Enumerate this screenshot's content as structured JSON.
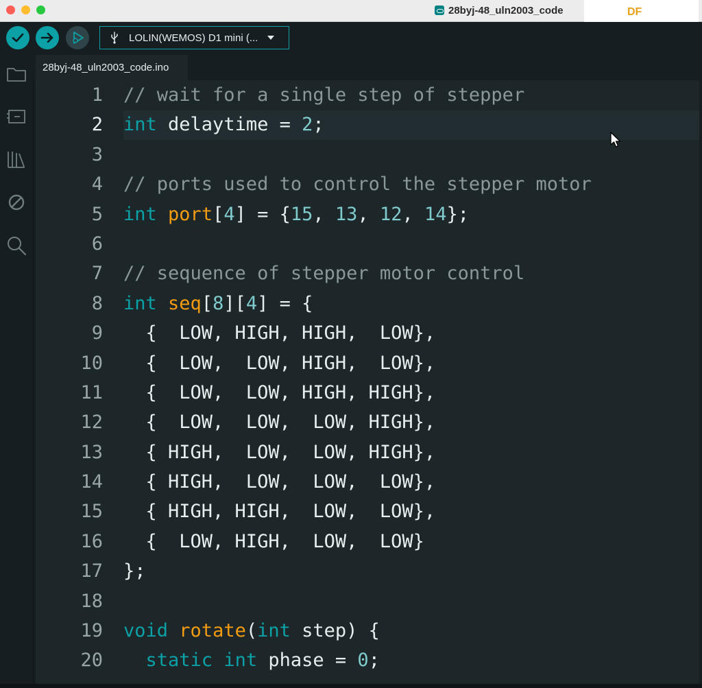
{
  "window": {
    "title": "28byj-48_uln2003_code",
    "app_icon": "arduino-icon",
    "watermark": "DF"
  },
  "toolbar": {
    "verify_icon": "check-icon",
    "upload_icon": "arrow-right-icon",
    "debug_icon": "debug-icon",
    "board_label": "LOLIN(WEMOS) D1 mini (...",
    "board_icon": "usb-icon"
  },
  "sidebar": {
    "items": [
      {
        "icon": "folder-icon"
      },
      {
        "icon": "board-manager-icon"
      },
      {
        "icon": "library-icon"
      },
      {
        "icon": "debug-disabled-icon"
      },
      {
        "icon": "search-icon"
      }
    ]
  },
  "tabs": [
    {
      "label": "28byj-48_uln2003_code.ino",
      "active": true
    }
  ],
  "editor": {
    "active_line": 2,
    "colors": {
      "comment": "#8a989c",
      "keyword": "#0ca1a6",
      "type": "#0ca1a6",
      "function": "#f39c12",
      "number": "#7fcbcd",
      "text": "#e6eef0"
    },
    "lines": [
      {
        "n": "1",
        "tokens": [
          {
            "t": "// wait for a single step of stepper",
            "c": "comment"
          }
        ]
      },
      {
        "n": "2",
        "tokens": [
          {
            "t": "int",
            "c": "keyword"
          },
          {
            "t": " delaytime = ",
            "c": "text"
          },
          {
            "t": "2",
            "c": "number"
          },
          {
            "t": ";",
            "c": "text"
          }
        ]
      },
      {
        "n": "3",
        "tokens": []
      },
      {
        "n": "4",
        "tokens": [
          {
            "t": "// ports used to control the stepper motor",
            "c": "comment"
          }
        ]
      },
      {
        "n": "5",
        "tokens": [
          {
            "t": "int",
            "c": "keyword"
          },
          {
            "t": " ",
            "c": "text"
          },
          {
            "t": "port",
            "c": "function"
          },
          {
            "t": "[",
            "c": "text"
          },
          {
            "t": "4",
            "c": "number"
          },
          {
            "t": "] = {",
            "c": "text"
          },
          {
            "t": "15",
            "c": "number"
          },
          {
            "t": ", ",
            "c": "text"
          },
          {
            "t": "13",
            "c": "number"
          },
          {
            "t": ", ",
            "c": "text"
          },
          {
            "t": "12",
            "c": "number"
          },
          {
            "t": ", ",
            "c": "text"
          },
          {
            "t": "14",
            "c": "number"
          },
          {
            "t": "};",
            "c": "text"
          }
        ]
      },
      {
        "n": "6",
        "tokens": []
      },
      {
        "n": "7",
        "tokens": [
          {
            "t": "// sequence of stepper motor control",
            "c": "comment"
          }
        ]
      },
      {
        "n": "8",
        "tokens": [
          {
            "t": "int",
            "c": "keyword"
          },
          {
            "t": " ",
            "c": "text"
          },
          {
            "t": "seq",
            "c": "function"
          },
          {
            "t": "[",
            "c": "text"
          },
          {
            "t": "8",
            "c": "number"
          },
          {
            "t": "][",
            "c": "text"
          },
          {
            "t": "4",
            "c": "number"
          },
          {
            "t": "] = {",
            "c": "text"
          }
        ]
      },
      {
        "n": "9",
        "tokens": [
          {
            "t": "  {  LOW, HIGH, HIGH,  LOW},",
            "c": "text"
          }
        ]
      },
      {
        "n": "10",
        "tokens": [
          {
            "t": "  {  LOW,  LOW, HIGH,  LOW},",
            "c": "text"
          }
        ]
      },
      {
        "n": "11",
        "tokens": [
          {
            "t": "  {  LOW,  LOW, HIGH, HIGH},",
            "c": "text"
          }
        ]
      },
      {
        "n": "12",
        "tokens": [
          {
            "t": "  {  LOW,  LOW,  LOW, HIGH},",
            "c": "text"
          }
        ]
      },
      {
        "n": "13",
        "tokens": [
          {
            "t": "  { HIGH,  LOW,  LOW, HIGH},",
            "c": "text"
          }
        ]
      },
      {
        "n": "14",
        "tokens": [
          {
            "t": "  { HIGH,  LOW,  LOW,  LOW},",
            "c": "text"
          }
        ]
      },
      {
        "n": "15",
        "tokens": [
          {
            "t": "  { HIGH, HIGH,  LOW,  LOW},",
            "c": "text"
          }
        ]
      },
      {
        "n": "16",
        "tokens": [
          {
            "t": "  {  LOW, HIGH,  LOW,  LOW}",
            "c": "text"
          }
        ]
      },
      {
        "n": "17",
        "tokens": [
          {
            "t": "};",
            "c": "text"
          }
        ]
      },
      {
        "n": "18",
        "tokens": []
      },
      {
        "n": "19",
        "tokens": [
          {
            "t": "void",
            "c": "keyword"
          },
          {
            "t": " ",
            "c": "text"
          },
          {
            "t": "rotate",
            "c": "function"
          },
          {
            "t": "(",
            "c": "text"
          },
          {
            "t": "int",
            "c": "keyword"
          },
          {
            "t": " step) {",
            "c": "text"
          }
        ]
      },
      {
        "n": "20",
        "tokens": [
          {
            "t": "  ",
            "c": "text"
          },
          {
            "t": "static",
            "c": "keyword"
          },
          {
            "t": " ",
            "c": "text"
          },
          {
            "t": "int",
            "c": "keyword"
          },
          {
            "t": " phase = ",
            "c": "text"
          },
          {
            "t": "0",
            "c": "number"
          },
          {
            "t": ";",
            "c": "text"
          }
        ]
      }
    ]
  }
}
